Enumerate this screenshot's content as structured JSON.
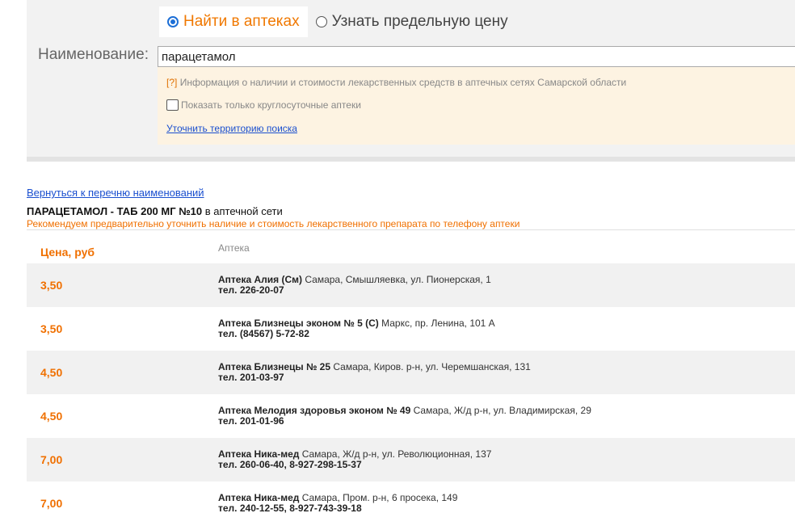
{
  "search": {
    "mode_find_label": "Найти в аптеках",
    "mode_price_label": "Узнать предельную цену",
    "name_label": "Наименование:",
    "name_value": "парацетамол",
    "info_marker": "[?]",
    "info_text": "Информация о наличии и стоимости лекарственных средств в аптечных сетях Самарской области",
    "only_24h_label": "Показать только круглосуточные аптеки",
    "territory_link": "Уточнить территорию поиска"
  },
  "results": {
    "back_link": "Вернуться к перечню наименований",
    "product_name": "ПАРАЦЕТАМОЛ - ТАБ 200 МГ №10",
    "product_suffix": " в аптечной сети",
    "recommendation": "Рекомендуем предварительно уточнить наличие и стоимость лекарственного препарата по телефону аптеки",
    "columns": {
      "price": "Цена, руб",
      "pharmacy": "Аптека"
    },
    "rows": [
      {
        "price": "3,50",
        "name": "Аптека Алия (См)",
        "address": " Самара, Смышляевка, ул. Пионерская, 1",
        "phone": "тел. 226-20-07"
      },
      {
        "price": "3,50",
        "name": "Аптека Близнецы эконом № 5 (С)",
        "address": " Маркс, пр. Ленина, 101 А",
        "phone": "тел. (84567) 5-72-82"
      },
      {
        "price": "4,50",
        "name": "Аптека Близнецы № 25",
        "address": "  Самара, Киров. р-н, ул. Черемшанская, 131",
        "phone": "тел. 201-03-97"
      },
      {
        "price": "4,50",
        "name": "Аптека Мелодия здоровья эконом № 49",
        "address": "  Самара, Ж/д р-н, ул. Владимирская, 29",
        "phone": "тел. 201-01-96"
      },
      {
        "price": "7,00",
        "name": "Аптека Ника-мед",
        "address": " Самара, Ж/д р-н, ул. Революционная, 137",
        "phone": "тел. 260-06-40, 8-927-298-15-37"
      },
      {
        "price": "7,00",
        "name": "Аптека Ника-мед",
        "address": " Самара, Пром. р-н, 6 просека, 149",
        "phone": "тел. 240-12-55, 8-927-743-39-18"
      }
    ]
  }
}
